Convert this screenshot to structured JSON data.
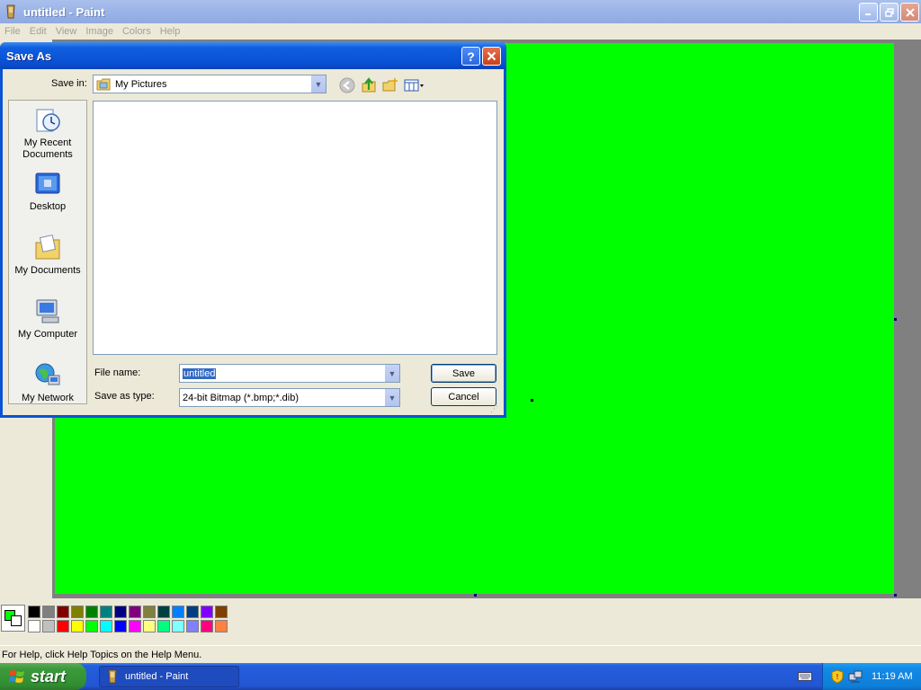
{
  "paint": {
    "title": "untitled - Paint",
    "menu": [
      "File",
      "Edit",
      "View",
      "Image",
      "Colors",
      "Help"
    ],
    "canvas_color": "#00ff00",
    "status_text": "For Help, click Help Topics on the Help Menu.",
    "palette": {
      "foreground": "#00ff00",
      "background": "#ffffff",
      "row1": [
        "#000000",
        "#808080",
        "#800000",
        "#808000",
        "#008000",
        "#008080",
        "#000080",
        "#800080",
        "#808040",
        "#004040",
        "#0080ff",
        "#004080",
        "#8000ff",
        "#804000"
      ],
      "row2": [
        "#ffffff",
        "#c0c0c0",
        "#ff0000",
        "#ffff00",
        "#00ff00",
        "#00ffff",
        "#0000ff",
        "#ff00ff",
        "#ffff80",
        "#00ff80",
        "#80ffff",
        "#8080ff",
        "#ff0080",
        "#ff8040"
      ]
    }
  },
  "dialog": {
    "title": "Save As",
    "help_label": "?",
    "close_label": "X",
    "save_in_label": "Save in:",
    "save_in_value": "My Pictures",
    "places": [
      {
        "label_line1": "My Recent",
        "label_line2": "Documents",
        "icon": "recent-documents-icon"
      },
      {
        "label_line1": "Desktop",
        "label_line2": "",
        "icon": "desktop-icon"
      },
      {
        "label_line1": "My Documents",
        "label_line2": "",
        "icon": "my-documents-icon"
      },
      {
        "label_line1": "My Computer",
        "label_line2": "",
        "icon": "my-computer-icon"
      },
      {
        "label_line1": "My Network",
        "label_line2": "",
        "icon": "my-network-icon"
      }
    ],
    "file_name_label": "File name:",
    "file_name_value": "untitled",
    "save_as_type_label": "Save as type:",
    "save_as_type_value": "24-bit Bitmap (*.bmp;*.dib)",
    "save_button": "Save",
    "cancel_button": "Cancel"
  },
  "taskbar": {
    "start_label": "start",
    "task_label": "untitled - Paint",
    "clock": "11:19 AM"
  }
}
